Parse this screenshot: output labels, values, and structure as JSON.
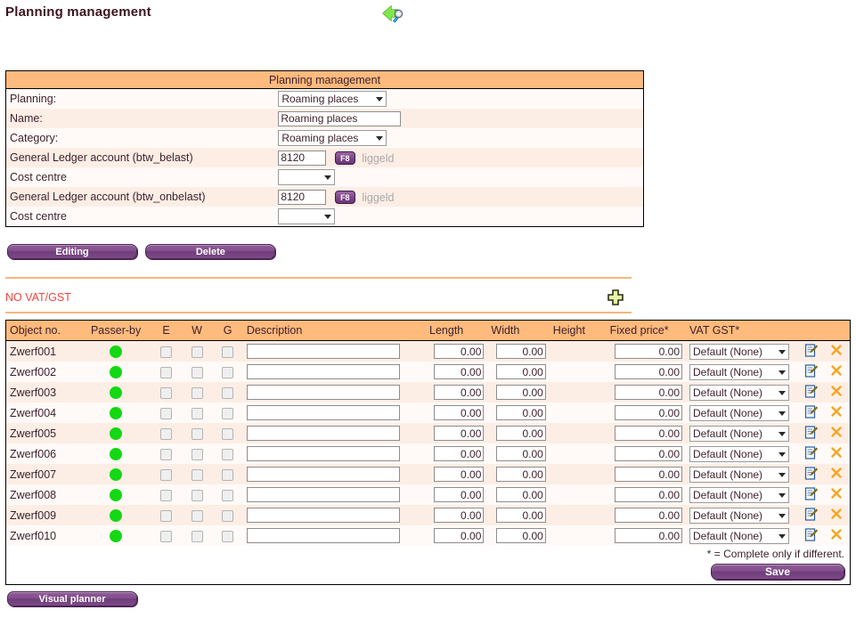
{
  "header": {
    "title": "Planning management",
    "back_icon": "back-arrow-search-icon"
  },
  "form": {
    "caption": "Planning management",
    "rows": [
      {
        "label": "Planning:",
        "type": "select",
        "value": "Roaming places"
      },
      {
        "label": "Name:",
        "type": "text",
        "value": "Roaming places"
      },
      {
        "label": "Category:",
        "type": "select",
        "value": "Roaming places"
      },
      {
        "label": "General Ledger account (btw_belast)",
        "type": "lookup",
        "value": "8120",
        "button": "F8",
        "hint": "liggeld"
      },
      {
        "label": "Cost centre",
        "type": "select",
        "value": ""
      },
      {
        "label": "General Ledger account (btw_onbelast)",
        "type": "lookup",
        "value": "8120",
        "button": "F8",
        "hint": "liggeld"
      },
      {
        "label": "Cost centre",
        "type": "select",
        "value": ""
      }
    ]
  },
  "actions": {
    "editing_label": "Editing",
    "delete_label": "Delete"
  },
  "vat_section": {
    "status_text": "NO VAT/GST",
    "status_color": "#f4443a",
    "add_icon": "plus-icon"
  },
  "objects_table": {
    "columns": [
      "Object no.",
      "Passer-by",
      "E",
      "W",
      "G",
      "Description",
      "Length",
      "Width",
      "Height",
      "Fixed price*",
      "VAT GST*"
    ],
    "rows": [
      {
        "object_no": "Zwerf001",
        "status_color": "#13d813",
        "e": false,
        "w": false,
        "g": false,
        "description": "",
        "length": "0.00",
        "width": "0.00",
        "height": "",
        "fixed_price": "0.00",
        "vat_gst": "Default (None)"
      },
      {
        "object_no": "Zwerf002",
        "status_color": "#13d813",
        "e": false,
        "w": false,
        "g": false,
        "description": "",
        "length": "0.00",
        "width": "0.00",
        "height": "",
        "fixed_price": "0.00",
        "vat_gst": "Default (None)"
      },
      {
        "object_no": "Zwerf003",
        "status_color": "#13d813",
        "e": false,
        "w": false,
        "g": false,
        "description": "",
        "length": "0.00",
        "width": "0.00",
        "height": "",
        "fixed_price": "0.00",
        "vat_gst": "Default (None)"
      },
      {
        "object_no": "Zwerf004",
        "status_color": "#13d813",
        "e": false,
        "w": false,
        "g": false,
        "description": "",
        "length": "0.00",
        "width": "0.00",
        "height": "",
        "fixed_price": "0.00",
        "vat_gst": "Default (None)"
      },
      {
        "object_no": "Zwerf005",
        "status_color": "#13d813",
        "e": false,
        "w": false,
        "g": false,
        "description": "",
        "length": "0.00",
        "width": "0.00",
        "height": "",
        "fixed_price": "0.00",
        "vat_gst": "Default (None)"
      },
      {
        "object_no": "Zwerf006",
        "status_color": "#13d813",
        "e": false,
        "w": false,
        "g": false,
        "description": "",
        "length": "0.00",
        "width": "0.00",
        "height": "",
        "fixed_price": "0.00",
        "vat_gst": "Default (None)"
      },
      {
        "object_no": "Zwerf007",
        "status_color": "#13d813",
        "e": false,
        "w": false,
        "g": false,
        "description": "",
        "length": "0.00",
        "width": "0.00",
        "height": "",
        "fixed_price": "0.00",
        "vat_gst": "Default (None)"
      },
      {
        "object_no": "Zwerf008",
        "status_color": "#13d813",
        "e": false,
        "w": false,
        "g": false,
        "description": "",
        "length": "0.00",
        "width": "0.00",
        "height": "",
        "fixed_price": "0.00",
        "vat_gst": "Default (None)"
      },
      {
        "object_no": "Zwerf009",
        "status_color": "#13d813",
        "e": false,
        "w": false,
        "g": false,
        "description": "",
        "length": "0.00",
        "width": "0.00",
        "height": "",
        "fixed_price": "0.00",
        "vat_gst": "Default (None)"
      },
      {
        "object_no": "Zwerf010",
        "status_color": "#13d813",
        "e": false,
        "w": false,
        "g": false,
        "description": "",
        "length": "0.00",
        "width": "0.00",
        "height": "",
        "fixed_price": "0.00",
        "vat_gst": "Default (None)"
      }
    ],
    "row_icons": {
      "edit": "edit-note-icon",
      "delete": "delete-x-icon"
    },
    "footnote": "* = Complete only if different.",
    "save_label": "Save"
  },
  "footer": {
    "visual_planner_label": "Visual planner"
  },
  "theme": {
    "header_orange": "#ffba7d",
    "row_peach": "#fdeee5",
    "row_white": "#fffaf7",
    "purple": "#7d4487",
    "rule_orange": "#f6b67e"
  }
}
